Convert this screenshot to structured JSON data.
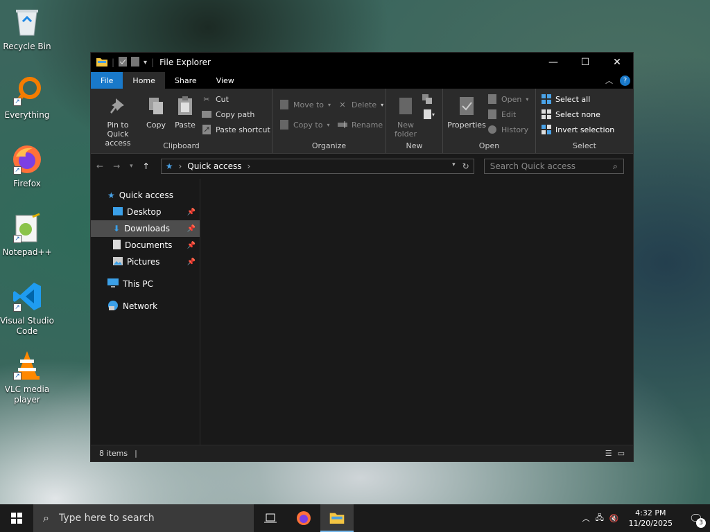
{
  "desktop": {
    "icons": [
      {
        "label": "Recycle Bin"
      },
      {
        "label": "Everything"
      },
      {
        "label": "Firefox"
      },
      {
        "label": "Notepad++"
      },
      {
        "label": "Visual Studio Code"
      },
      {
        "label": "VLC media player"
      }
    ]
  },
  "window": {
    "title": "File Explorer",
    "controls": {
      "minimize": "—",
      "maximize": "☐",
      "close": "✕"
    }
  },
  "tabs": {
    "file": "File",
    "home": "Home",
    "share": "Share",
    "view": "View",
    "help": "?"
  },
  "ribbon": {
    "clipboard": {
      "label": "Clipboard",
      "pin": "Pin to Quick access",
      "copy": "Copy",
      "paste": "Paste",
      "cut": "Cut",
      "copy_path": "Copy path",
      "paste_shortcut": "Paste shortcut"
    },
    "organize": {
      "label": "Organize",
      "move_to": "Move to",
      "copy_to": "Copy to",
      "delete": "Delete",
      "rename": "Rename"
    },
    "new": {
      "label": "New",
      "new_folder": "New folder"
    },
    "open": {
      "label": "Open",
      "properties": "Properties",
      "open": "Open",
      "edit": "Edit",
      "history": "History"
    },
    "select": {
      "label": "Select",
      "select_all": "Select all",
      "select_none": "Select none",
      "invert": "Invert selection"
    }
  },
  "address": {
    "path": "Quick access",
    "search_placeholder": "Search Quick access"
  },
  "navpane": {
    "quick_access": "Quick access",
    "items": [
      {
        "label": "Desktop"
      },
      {
        "label": "Downloads"
      },
      {
        "label": "Documents"
      },
      {
        "label": "Pictures"
      }
    ],
    "this_pc": "This PC",
    "network": "Network"
  },
  "status": {
    "items": "8 items"
  },
  "taskbar": {
    "search_placeholder": "Type here to search",
    "time": "4:32 PM",
    "date": "11/20/2025",
    "notifications": "3"
  }
}
